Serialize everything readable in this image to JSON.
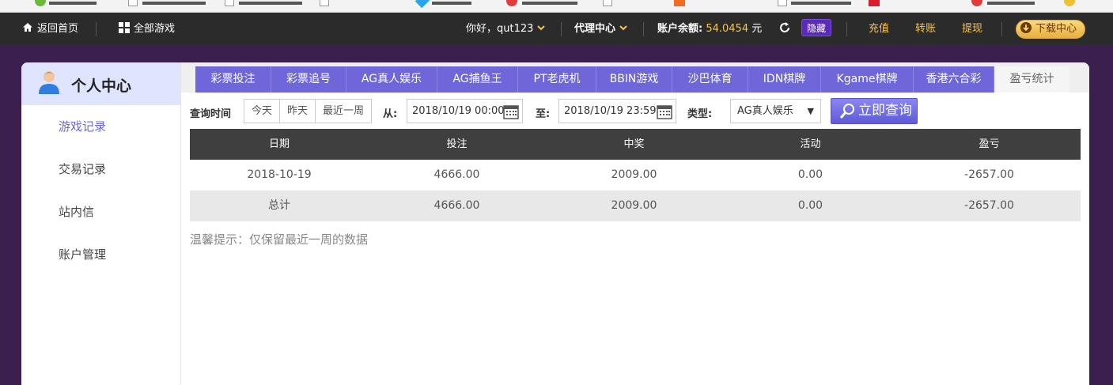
{
  "topbar": {
    "home_label": "返回首页",
    "all_games_label": "全部游戏",
    "greeting": "你好，qut123",
    "agent_center_label": "代理中心",
    "balance_label": "账户余额:",
    "balance_value": "54.0454",
    "currency": "元",
    "hide_label": "隐藏",
    "recharge_label": "充值",
    "transfer_label": "转账",
    "withdraw_label": "提现",
    "download_label": "下载中心"
  },
  "sidebar": {
    "title": "个人中心",
    "items": [
      {
        "label": "游戏记录",
        "active": true
      },
      {
        "label": "交易记录",
        "active": false
      },
      {
        "label": "站内信",
        "active": false
      },
      {
        "label": "账户管理",
        "active": false
      }
    ]
  },
  "tabs": [
    {
      "label": "彩票投注"
    },
    {
      "label": "彩票追号"
    },
    {
      "label": "AG真人娱乐"
    },
    {
      "label": "AG捕鱼王"
    },
    {
      "label": "PT老虎机"
    },
    {
      "label": "BBIN游戏"
    },
    {
      "label": "沙巴体育"
    },
    {
      "label": "IDN棋牌"
    },
    {
      "label": "Kgame棋牌"
    },
    {
      "label": "香港六合彩"
    },
    {
      "label": "盈亏统计",
      "active": true
    }
  ],
  "filter": {
    "query_time_label": "查询时间",
    "quick_buttons": [
      "今天",
      "昨天",
      "最近一周"
    ],
    "from_label": "从:",
    "from_value": "2018/10/19 00:00",
    "to_label": "至:",
    "to_value": "2018/10/19 23:59",
    "type_label": "类型:",
    "type_value": "AG真人娱乐",
    "query_button": "立即查询"
  },
  "table": {
    "headers": [
      "日期",
      "投注",
      "中奖",
      "活动",
      "盈亏"
    ],
    "rows": [
      [
        "2018-10-19",
        "4666.00",
        "2009.00",
        "0.00",
        "-2657.00"
      ],
      [
        "总计",
        "4666.00",
        "2009.00",
        "0.00",
        "-2657.00"
      ]
    ]
  },
  "tip": "温馨提示：仅保留最近一周的数据",
  "colors": {
    "accent": "#6f67d9",
    "gold": "#f5c453",
    "topbar": "#2b2b2b",
    "table_header": "#3f3f3f"
  }
}
